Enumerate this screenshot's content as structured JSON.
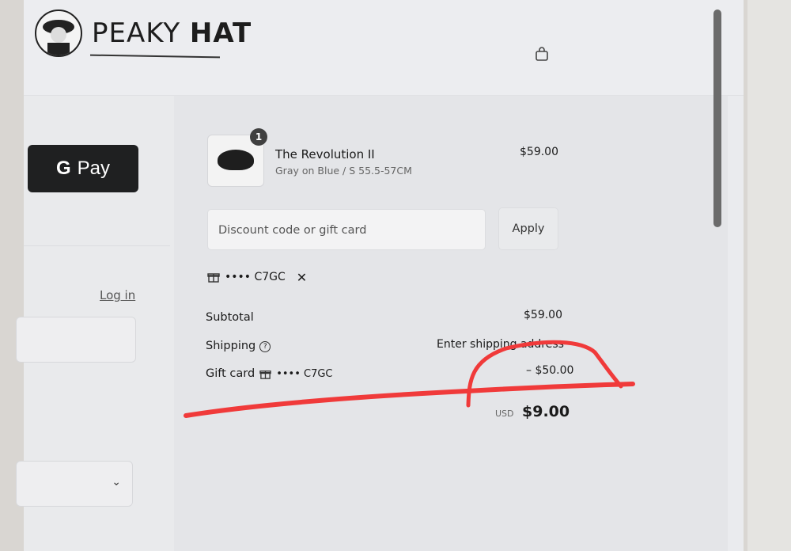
{
  "brand": {
    "name_light": "PEAKY",
    "name_bold": "HAT"
  },
  "header": {
    "cart_icon": "shopping-bag-icon"
  },
  "left": {
    "gpay_logo": "G",
    "gpay_label": "Pay",
    "login_link": "Log in",
    "select_icon": "chevron-down-icon"
  },
  "product": {
    "quantity": "1",
    "name": "The Revolution II",
    "variant": "Gray on Blue / S 55.5-57CM",
    "price": "$59.00"
  },
  "discount": {
    "placeholder": "Discount code or gift card",
    "apply_label": "Apply",
    "applied_code": "•••• C7GC"
  },
  "summary": {
    "subtotal_label": "Subtotal",
    "subtotal_value": "$59.00",
    "shipping_label": "Shipping",
    "shipping_value": "Enter shipping address",
    "giftcard_label": "Gift card",
    "giftcard_code": "•••• C7GC",
    "giftcard_value": "– $50.00",
    "total_currency": "USD",
    "total_value": "$9.00"
  },
  "colors": {
    "marker": "#f03a3a",
    "button_dark": "#1f2021"
  }
}
